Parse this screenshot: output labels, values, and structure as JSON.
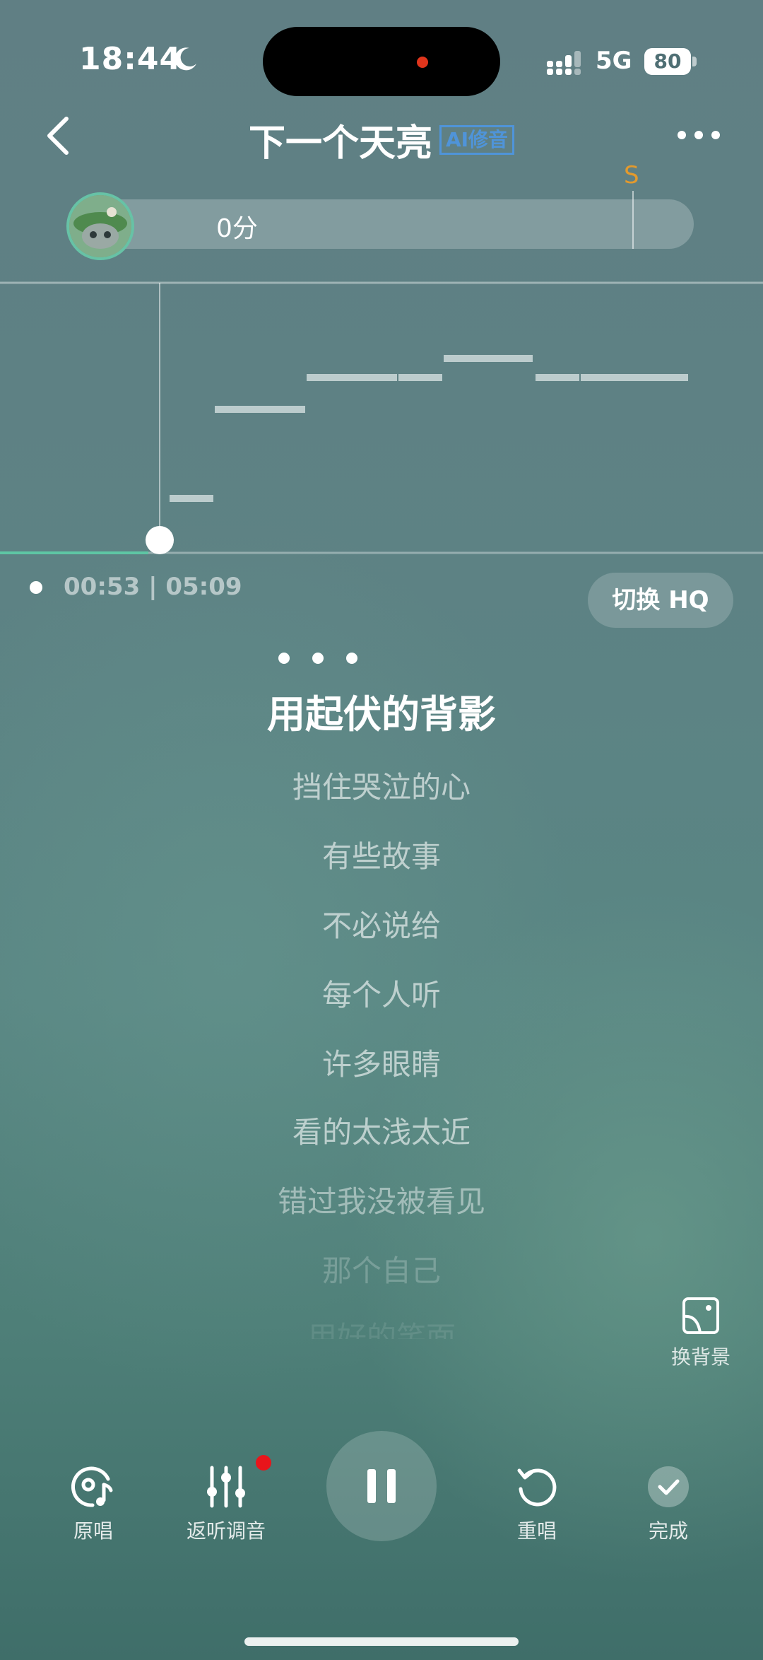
{
  "status_bar": {
    "time": "18:44",
    "network": "5G",
    "battery": "80"
  },
  "nav": {
    "title": "下一个天亮",
    "ai_badge": "AI修音"
  },
  "score": {
    "text": "0分",
    "grade_mark": "S"
  },
  "progress": {
    "time": "00:53 | 05:09"
  },
  "hq_button": "切换 HQ",
  "lyrics": {
    "current": "用起伏的背影",
    "upcoming": [
      "挡住哭泣的心",
      "有些故事",
      "不必说给",
      "每个人听",
      "许多眼睛",
      "看的太浅太近",
      "错过我没被看见",
      "那个自己",
      "用好的笑面"
    ]
  },
  "change_background": "换背景",
  "controls": {
    "original": "原唱",
    "playback_tune": "返听调音",
    "retry": "重唱",
    "done": "完成"
  }
}
